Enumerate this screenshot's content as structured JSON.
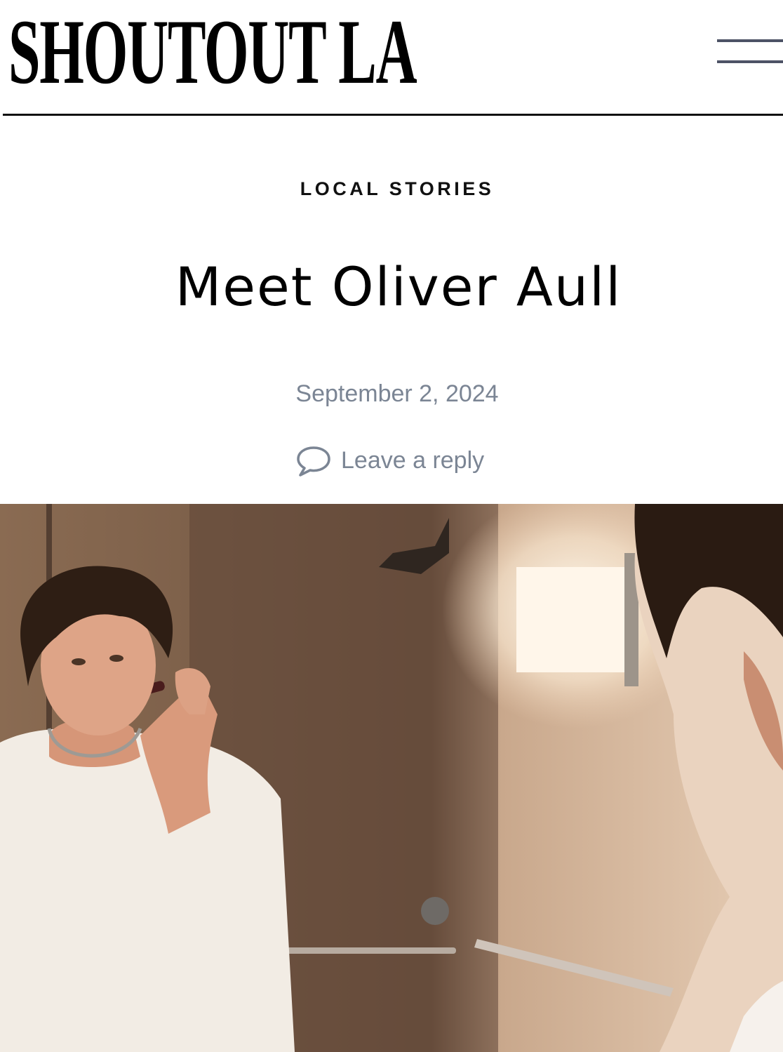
{
  "header": {
    "logo_text": "SHOUTOUT LA",
    "menu_icon": "hamburger-menu-icon"
  },
  "article": {
    "category": "LOCAL STORIES",
    "title": "Meet Oliver Aull",
    "date": "September 2, 2024",
    "reply_label": "Leave a reply",
    "reply_icon": "comment-bubble-icon"
  },
  "colors": {
    "text": "#000000",
    "meta": "#7b8594",
    "menu_bars": "#4d5366",
    "rule": "#111111"
  }
}
